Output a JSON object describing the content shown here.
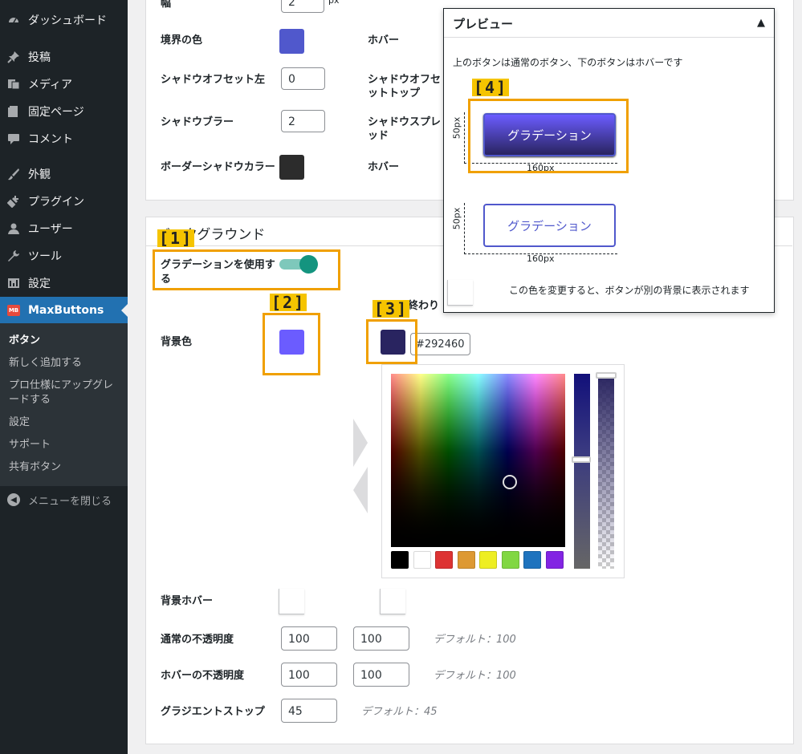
{
  "sidebar": {
    "items": [
      {
        "label": "ダッシュボード",
        "icon": "dashboard-icon"
      },
      {
        "label": "投稿",
        "icon": "pin-icon"
      },
      {
        "label": "メディア",
        "icon": "media-icon"
      },
      {
        "label": "固定ページ",
        "icon": "page-icon"
      },
      {
        "label": "コメント",
        "icon": "comment-icon"
      },
      {
        "label": "外観",
        "icon": "appearance-icon"
      },
      {
        "label": "プラグイン",
        "icon": "plugin-icon"
      },
      {
        "label": "ユーザー",
        "icon": "user-icon"
      },
      {
        "label": "ツール",
        "icon": "wrench-icon"
      },
      {
        "label": "設定",
        "icon": "settings-icon"
      },
      {
        "label": "MaxButtons",
        "icon": "maxbuttons-icon"
      }
    ],
    "submenu": [
      "ボタン",
      "新しく追加する",
      "プロ仕様にアップグレードする",
      "設定",
      "サポート",
      "共有ボタン"
    ],
    "collapse_label": "メニューを閉じる",
    "maxbuttons_logo_text": "MB"
  },
  "border_panel": {
    "width_label": "幅",
    "width_value": "2",
    "width_unit": "px",
    "border_color_label": "境界の色",
    "border_color": "#5058cc",
    "hover_label": "ホバー",
    "shadow_offset_left_label": "シャドウオフセット左",
    "shadow_offset_left_value": "0",
    "shadow_offset_top_label": "シャドウオフセットトップ",
    "shadow_blur_label": "シャドウブラー",
    "shadow_blur_value": "2",
    "shadow_spread_label": "シャドウスプレッド",
    "border_shadow_color_label": "ボーダーシャドウカラー",
    "border_shadow_color": "#2c2c2c",
    "hover2_label": "ホバー"
  },
  "background_panel": {
    "title": "バックグラウンド",
    "use_gradient_label": "グラデーションを使用する",
    "gradient_on": true,
    "bg_color_label": "背景色",
    "end_label": "終わり",
    "start_color": "#6b5cff",
    "end_color": "#292460",
    "end_color_hex": "#292460",
    "bg_hover_label": "背景ホバー",
    "normal_opacity_label": "通常の不透明度",
    "normal_opacity_start": "100",
    "normal_opacity_end": "100",
    "normal_opacity_hint": "デフォルト：100",
    "hover_opacity_label": "ホバーの不透明度",
    "hover_opacity_start": "100",
    "hover_opacity_end": "100",
    "hover_opacity_hint": "デフォルト：100",
    "gradient_stop_label": "グラジエントストップ",
    "gradient_stop_value": "45",
    "gradient_stop_hint": "デフォルト：45"
  },
  "palette": [
    "#000000",
    "#ffffff",
    "#dd3333",
    "#dd9933",
    "#eeee22",
    "#81d742",
    "#1e73be",
    "#8224e3"
  ],
  "preview": {
    "title": "プレビュー",
    "toggle_glyph": "▲",
    "description": "上のボタンは通常のボタン、下のボタンはホバーです",
    "button_text": "グラデーション",
    "height_label": "50px",
    "width_label": "160px",
    "bg_note": "この色を変更すると、ボタンが別の背景に表示されます"
  },
  "callouts": [
    "[1]",
    "[2]",
    "[3]",
    "[4]"
  ]
}
